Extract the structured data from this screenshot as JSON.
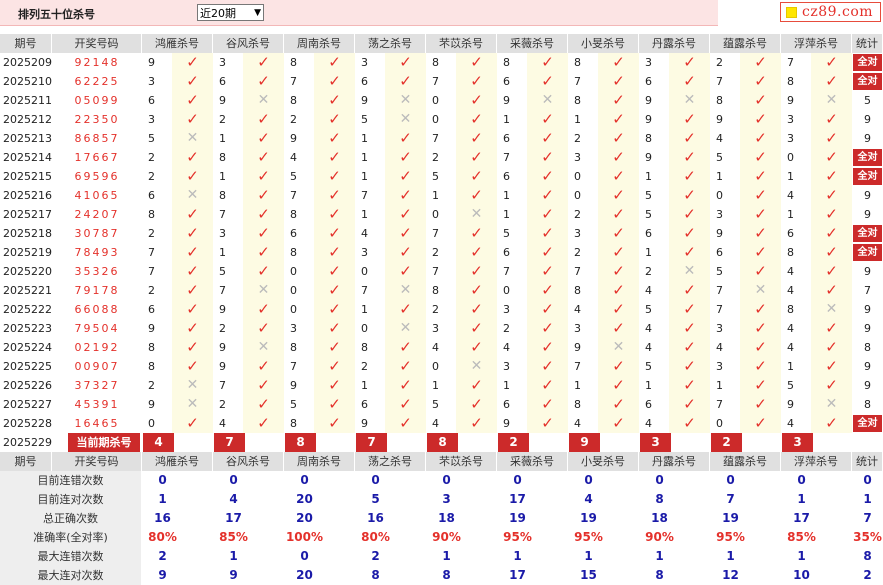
{
  "header": {
    "title": "排列五十位杀号",
    "period_select": "近20期",
    "logo": "cz89.com"
  },
  "table": {
    "col_period": "期号",
    "col_draw": "开奖号码",
    "experts": [
      "鸿雁杀号",
      "谷风杀号",
      "周南杀号",
      "荡之杀号",
      "芣苡杀号",
      "采薇杀号",
      "小旻杀号",
      "丹露杀号",
      "蕴露杀号",
      "浮萍杀号"
    ],
    "col_stat": "统计",
    "all_correct_label": "全对",
    "rows": [
      {
        "period": "2025209",
        "draw": "92148",
        "kills": [
          9,
          3,
          8,
          3,
          8,
          8,
          8,
          3,
          2,
          7
        ],
        "marks": [
          1,
          1,
          1,
          1,
          1,
          1,
          1,
          1,
          1,
          1
        ],
        "stat": "全对"
      },
      {
        "period": "2025210",
        "draw": "62225",
        "kills": [
          3,
          6,
          7,
          6,
          7,
          6,
          7,
          6,
          7,
          8
        ],
        "marks": [
          1,
          1,
          1,
          1,
          1,
          1,
          1,
          1,
          1,
          1
        ],
        "stat": "全对"
      },
      {
        "period": "2025211",
        "draw": "05099",
        "kills": [
          6,
          9,
          8,
          9,
          0,
          9,
          8,
          9,
          8,
          9
        ],
        "marks": [
          1,
          0,
          1,
          0,
          1,
          0,
          1,
          0,
          1,
          0
        ],
        "stat": "5"
      },
      {
        "period": "2025212",
        "draw": "22350",
        "kills": [
          3,
          2,
          2,
          5,
          0,
          1,
          1,
          9,
          9,
          3
        ],
        "marks": [
          1,
          1,
          1,
          0,
          1,
          1,
          1,
          1,
          1,
          1
        ],
        "stat": "9"
      },
      {
        "period": "2025213",
        "draw": "86857",
        "kills": [
          5,
          1,
          9,
          1,
          7,
          6,
          2,
          8,
          4,
          3
        ],
        "marks": [
          0,
          1,
          1,
          1,
          1,
          1,
          1,
          1,
          1,
          1
        ],
        "stat": "9"
      },
      {
        "period": "2025214",
        "draw": "17667",
        "kills": [
          2,
          8,
          4,
          1,
          2,
          7,
          3,
          9,
          5,
          0
        ],
        "marks": [
          1,
          1,
          1,
          1,
          1,
          1,
          1,
          1,
          1,
          1
        ],
        "stat": "全对"
      },
      {
        "period": "2025215",
        "draw": "69596",
        "kills": [
          2,
          1,
          5,
          1,
          5,
          6,
          0,
          1,
          1,
          1
        ],
        "marks": [
          1,
          1,
          1,
          1,
          1,
          1,
          1,
          1,
          1,
          1
        ],
        "stat": "全对"
      },
      {
        "period": "2025216",
        "draw": "41065",
        "kills": [
          6,
          8,
          7,
          7,
          1,
          1,
          0,
          5,
          0,
          4
        ],
        "marks": [
          0,
          1,
          1,
          1,
          1,
          1,
          1,
          1,
          1,
          1
        ],
        "stat": "9"
      },
      {
        "period": "2025217",
        "draw": "24207",
        "kills": [
          8,
          7,
          8,
          1,
          0,
          1,
          2,
          5,
          3,
          1
        ],
        "marks": [
          1,
          1,
          1,
          1,
          0,
          1,
          1,
          1,
          1,
          1
        ],
        "stat": "9"
      },
      {
        "period": "2025218",
        "draw": "30787",
        "kills": [
          2,
          3,
          6,
          4,
          7,
          5,
          3,
          6,
          9,
          6
        ],
        "marks": [
          1,
          1,
          1,
          1,
          1,
          1,
          1,
          1,
          1,
          1
        ],
        "stat": "全对"
      },
      {
        "period": "2025219",
        "draw": "78493",
        "kills": [
          7,
          1,
          8,
          3,
          2,
          6,
          2,
          1,
          6,
          8
        ],
        "marks": [
          1,
          1,
          1,
          1,
          1,
          1,
          1,
          1,
          1,
          1
        ],
        "stat": "全对"
      },
      {
        "period": "2025220",
        "draw": "35326",
        "kills": [
          7,
          5,
          0,
          0,
          7,
          7,
          7,
          2,
          5,
          4
        ],
        "marks": [
          1,
          1,
          1,
          1,
          1,
          1,
          1,
          0,
          1,
          1
        ],
        "stat": "9"
      },
      {
        "period": "2025221",
        "draw": "79178",
        "kills": [
          2,
          7,
          0,
          7,
          8,
          0,
          8,
          4,
          7,
          4
        ],
        "marks": [
          1,
          0,
          1,
          0,
          1,
          1,
          1,
          1,
          0,
          1
        ],
        "stat": "7"
      },
      {
        "period": "2025222",
        "draw": "66088",
        "kills": [
          6,
          9,
          0,
          1,
          2,
          3,
          4,
          5,
          7,
          8
        ],
        "marks": [
          1,
          1,
          1,
          1,
          1,
          1,
          1,
          1,
          1,
          0
        ],
        "stat": "9"
      },
      {
        "period": "2025223",
        "draw": "79504",
        "kills": [
          9,
          2,
          3,
          0,
          3,
          2,
          3,
          4,
          3,
          4
        ],
        "marks": [
          1,
          1,
          1,
          0,
          1,
          1,
          1,
          1,
          1,
          1
        ],
        "stat": "9"
      },
      {
        "period": "2025224",
        "draw": "02192",
        "kills": [
          8,
          9,
          8,
          8,
          4,
          4,
          9,
          4,
          4,
          4
        ],
        "marks": [
          1,
          0,
          1,
          1,
          1,
          1,
          0,
          1,
          1,
          1
        ],
        "stat": "8"
      },
      {
        "period": "2025225",
        "draw": "00907",
        "kills": [
          8,
          9,
          7,
          2,
          0,
          3,
          7,
          5,
          3,
          1
        ],
        "marks": [
          1,
          1,
          1,
          1,
          0,
          1,
          1,
          1,
          1,
          1
        ],
        "stat": "9"
      },
      {
        "period": "2025226",
        "draw": "37327",
        "kills": [
          2,
          7,
          9,
          1,
          1,
          1,
          1,
          1,
          1,
          5
        ],
        "marks": [
          0,
          1,
          1,
          1,
          1,
          1,
          1,
          1,
          1,
          1
        ],
        "stat": "9"
      },
      {
        "period": "2025227",
        "draw": "45391",
        "kills": [
          9,
          2,
          5,
          6,
          5,
          6,
          8,
          6,
          7,
          9
        ],
        "marks": [
          0,
          1,
          1,
          1,
          1,
          1,
          1,
          1,
          1,
          0
        ],
        "stat": "8"
      },
      {
        "period": "2025228",
        "draw": "16465",
        "kills": [
          0,
          4,
          8,
          9,
          4,
          9,
          4,
          4,
          0,
          4
        ],
        "marks": [
          1,
          1,
          1,
          1,
          1,
          1,
          1,
          1,
          1,
          1
        ],
        "stat": "全对"
      }
    ],
    "current": {
      "period": "2025229",
      "label": "当前期杀号",
      "kills": [
        4,
        7,
        8,
        7,
        8,
        2,
        9,
        3,
        2,
        3
      ]
    }
  },
  "stats": {
    "rows": [
      {
        "label": "目前连错次数",
        "values": [
          "0",
          "0",
          "0",
          "0",
          "0",
          "0",
          "0",
          "0",
          "0",
          "0"
        ],
        "total": "0",
        "color": "blue"
      },
      {
        "label": "目前连对次数",
        "values": [
          "1",
          "4",
          "20",
          "5",
          "3",
          "17",
          "4",
          "8",
          "7",
          "1"
        ],
        "total": "1",
        "color": "blue"
      },
      {
        "label": "总正确次数",
        "values": [
          "16",
          "17",
          "20",
          "16",
          "18",
          "19",
          "19",
          "18",
          "19",
          "17"
        ],
        "total": "7",
        "color": "blue"
      },
      {
        "label": "准确率(全对率)",
        "values": [
          "80%",
          "85%",
          "100%",
          "80%",
          "90%",
          "95%",
          "95%",
          "90%",
          "95%",
          "85%"
        ],
        "total": "35%",
        "color": "red"
      },
      {
        "label": "最大连错次数",
        "values": [
          "2",
          "1",
          "0",
          "2",
          "1",
          "1",
          "1",
          "1",
          "1",
          "1"
        ],
        "total": "8",
        "color": "blue"
      },
      {
        "label": "最大连对次数",
        "values": [
          "9",
          "9",
          "20",
          "8",
          "8",
          "17",
          "15",
          "8",
          "12",
          "10"
        ],
        "total": "2",
        "color": "blue"
      }
    ]
  }
}
